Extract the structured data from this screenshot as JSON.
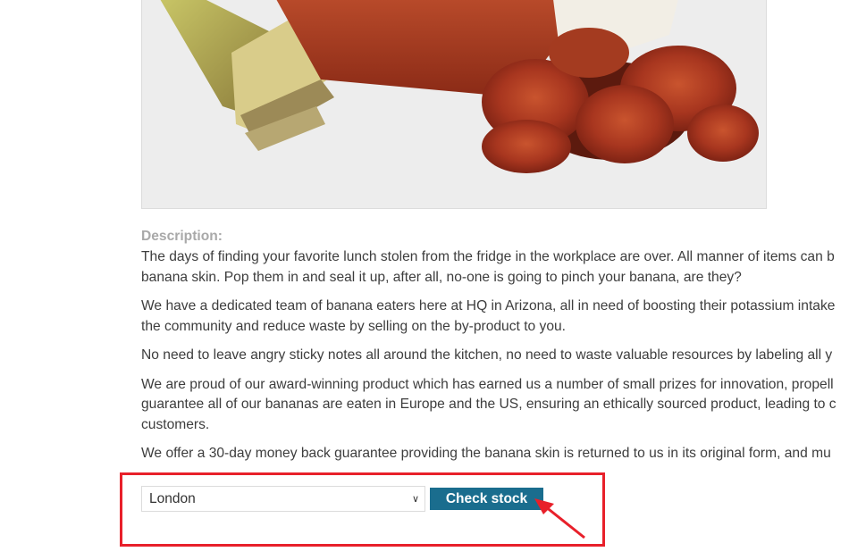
{
  "product": {
    "image_alt": "Banana peel with sliced chorizo sausage"
  },
  "description": {
    "heading": "Description:",
    "paragraphs": [
      [
        "The days of finding your favorite lunch stolen from the fridge in the workplace are over. All manner of items can b",
        "banana skin. Pop them in and seal it up, after all, no-one is going to pinch your banana, are they?"
      ],
      [
        "We have a dedicated team of banana eaters here at HQ in Arizona, all in need of boosting their potassium intake",
        "the community and reduce waste by selling on the by-product to you."
      ],
      [
        "No need to leave angry sticky notes all around the kitchen, no need to waste valuable resources by labeling all y"
      ],
      [
        "We are proud of our award-winning product which has earned us a number of small prizes for innovation, propell",
        "guarantee all of our bananas are eaten in Europe and the US, ensuring an ethically sourced product, leading to c",
        "customers."
      ],
      [
        "We offer a 30-day money back guarantee providing the banana skin is returned to us in its original form, and mu"
      ]
    ]
  },
  "stock_check": {
    "selected_store": "London",
    "button_label": "Check stock"
  },
  "annotation": {
    "highlight_color": "#e8202a"
  },
  "colors": {
    "button_bg": "#1a6d8e",
    "heading_color": "#a9a9a9",
    "text_color": "#3d3d3d"
  }
}
